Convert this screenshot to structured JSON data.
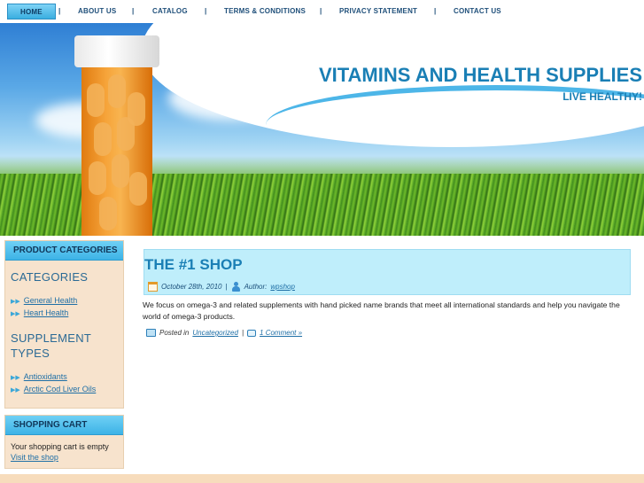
{
  "nav": {
    "items": [
      "HOME",
      "ABOUT US",
      "CATALOG",
      "TERMS & CONDITIONS",
      "PRIVACY STATEMENT",
      "CONTACT US"
    ],
    "separator": "|",
    "active": "HOME"
  },
  "header": {
    "title": "VITAMINS AND HEALTH SUPPLIES",
    "tagline": "LIVE HEALTHY!"
  },
  "sidebar": {
    "product_categories": {
      "title": "PRODUCT CATEGORIES",
      "categories_heading": "CATEGORIES",
      "categories": [
        "General Health",
        "Heart Health"
      ],
      "supplement_heading": "SUPPLEMENT TYPES",
      "supplements": [
        "Antioxidants",
        "Arctic Cod Liver Oils"
      ]
    },
    "cart": {
      "title": "SHOPPING CART",
      "empty_text": "Your shopping cart is empty",
      "link": "Visit the shop"
    }
  },
  "post": {
    "title": "THE #1 SHOP",
    "date": "October 28th, 2010",
    "meta_sep": "|",
    "author_label": "Author:",
    "author": "wpshop",
    "body": "We focus on omega-3 and related supplements with hand picked name brands that meet all international standards and help you navigate the world of omega-3 products.",
    "posted_in_label": "Posted in",
    "category": "Uncategorized",
    "comments": "1 Comment »"
  },
  "colors": {
    "accent": "#1a7fb5",
    "nav_active": "#3aaee0",
    "widget_bg": "#f7e3cd",
    "post_head_bg": "#bfeefb"
  }
}
